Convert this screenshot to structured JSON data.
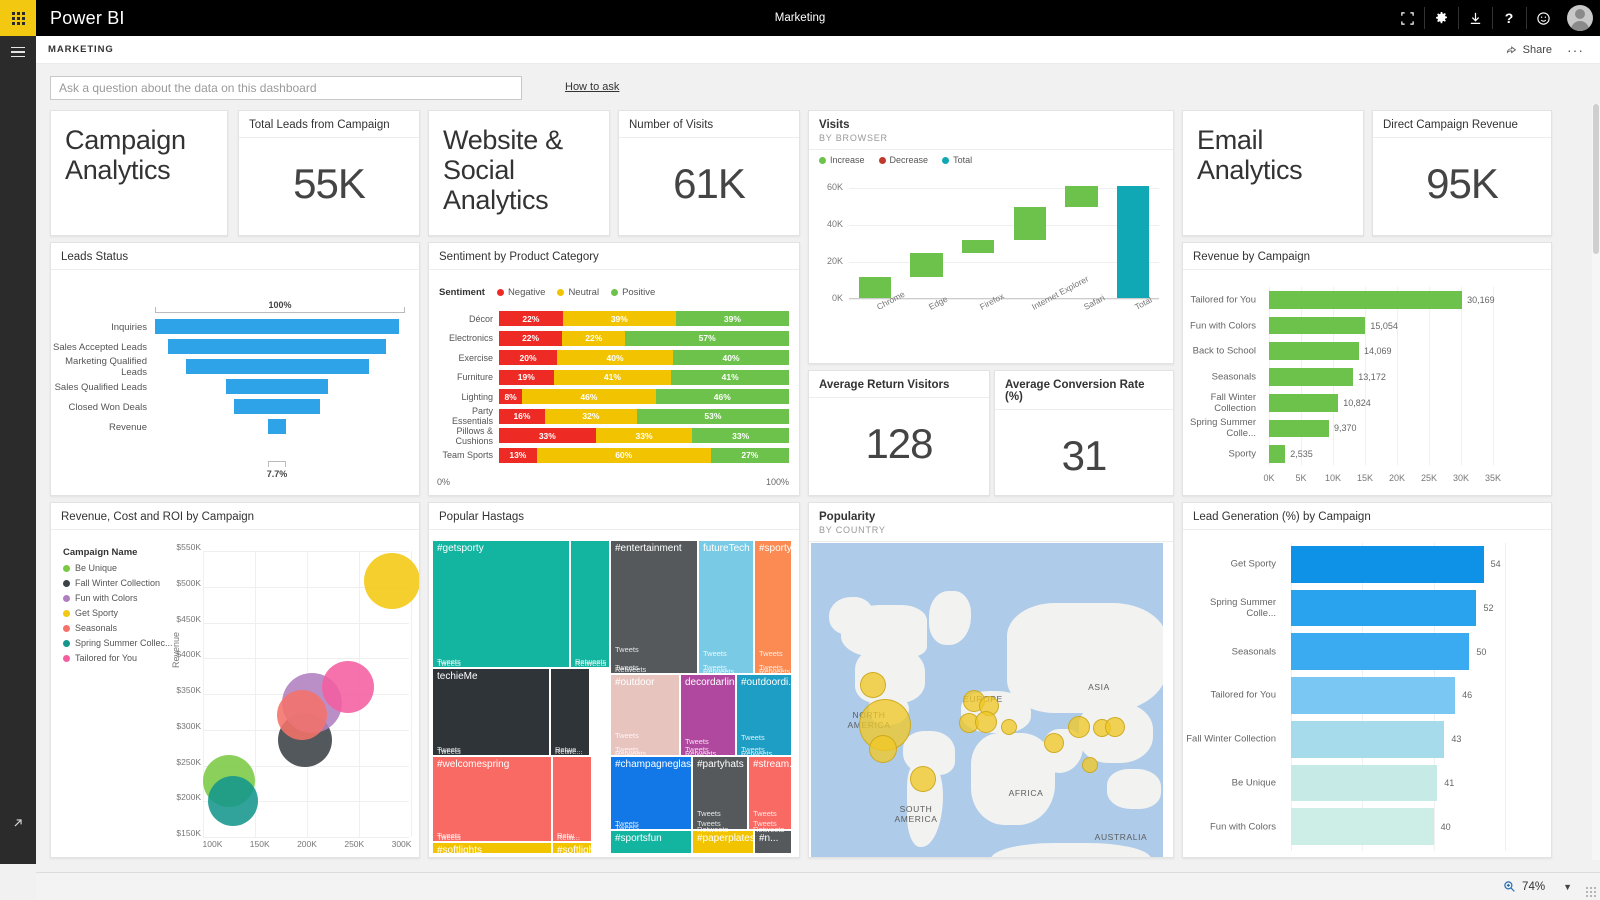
{
  "app": {
    "brand": "Power BI",
    "window_title": "Marketing",
    "waffle_icon": "app-launcher-grid-icon",
    "top_icons": [
      {
        "name": "fullscreen-icon",
        "label": "Full screen"
      },
      {
        "name": "gear-icon",
        "label": "Settings"
      },
      {
        "name": "download-icon",
        "label": "Download"
      },
      {
        "name": "help-icon",
        "label": "?"
      },
      {
        "name": "feedback-smiley-icon",
        "label": "Feedback"
      }
    ],
    "avatar_name": "user-avatar"
  },
  "breadcrumb": {
    "text": "MARKETING",
    "share_label": "Share",
    "share_icon": "share-icon",
    "more_label": "···"
  },
  "qna": {
    "placeholder": "Ask a question about the data on this dashboard",
    "value": "",
    "how_to_ask": "How to ask"
  },
  "status": {
    "zoom_level": "74%",
    "zoom_icon": "magnifier-plus-icon",
    "caret": "▼"
  },
  "tiles": {
    "campaign_analytics": {
      "title": "Campaign\nAnalytics",
      "line1": "Campaign",
      "line2": "Analytics"
    },
    "total_leads": {
      "title": "Total Leads from Campaign",
      "value": "55K"
    },
    "website_social": {
      "line1": "Website & Social",
      "line2": "Analytics"
    },
    "number_of_visits": {
      "title": "Number of Visits",
      "value": "61K"
    },
    "email_analytics": {
      "title": "Email Analytics"
    },
    "direct_campaign_revenue": {
      "title": "Direct Campaign Revenue",
      "value": "95K"
    },
    "leads_status": {
      "title": "Leads Status"
    },
    "sentiment": {
      "title": "Sentiment by Product Category"
    },
    "visits_browser": {
      "title": "Visits",
      "subtitle": "BY BROWSER"
    },
    "avg_return_visitors": {
      "title": "Average Return Visitors",
      "value": "128"
    },
    "avg_conversion_rate": {
      "title": "Average Conversion Rate (%)",
      "value": "31"
    },
    "revenue_by_campaign": {
      "title": "Revenue by Campaign"
    },
    "revenue_cost_roi": {
      "title": "Revenue, Cost and ROI by Campaign"
    },
    "popular_hashtags": {
      "title": "Popular Hastags"
    },
    "popularity": {
      "title": "Popularity",
      "subtitle": "BY COUNTRY"
    },
    "lead_generation": {
      "title": "Lead Generation (%) by Campaign"
    }
  },
  "chart_data": [
    {
      "id": "leads_status",
      "type": "bar",
      "title": "Leads Status",
      "orientation": "funnel",
      "categories": [
        "Inquiries",
        "Sales Accepted Leads",
        "Marketing Qualified Leads",
        "Sales Qualified Leads",
        "Closed Won Deals",
        "Revenue"
      ],
      "values": [
        100,
        89,
        75,
        42,
        35,
        7.7
      ],
      "top_label": "100%",
      "bottom_label": "7.7%",
      "color": "#2fa3e8",
      "xlabel": "",
      "ylabel": ""
    },
    {
      "id": "sentiment_by_product_category",
      "type": "bar",
      "title": "Sentiment by Product Category",
      "stacked": true,
      "legend_title": "Sentiment",
      "legend_position": "top",
      "categories": [
        "Décor",
        "Electronics",
        "Exercise",
        "Furniture",
        "Lighting",
        "Party Essentials",
        "Pillows & Cushions",
        "Team Sports"
      ],
      "series": [
        {
          "name": "Negative",
          "color": "#ee2a24",
          "values": [
            22,
            22,
            20,
            19,
            8,
            16,
            33,
            13
          ]
        },
        {
          "name": "Neutral",
          "color": "#f2c300",
          "values": [
            39,
            22,
            40,
            41,
            46,
            32,
            33,
            60
          ]
        },
        {
          "name": "Positive",
          "color": "#6cc24a",
          "values": [
            39,
            57,
            40,
            41,
            46,
            53,
            33,
            27
          ]
        }
      ],
      "axis_min_label": "0%",
      "axis_max_label": "100%",
      "xlabel": "",
      "ylabel": ""
    },
    {
      "id": "visits_by_browser",
      "type": "bar",
      "chart_style": "waterfall",
      "title": "Visits",
      "subtitle": "BY BROWSER",
      "legend": [
        {
          "name": "Increase",
          "color": "#6cc24a"
        },
        {
          "name": "Decrease",
          "color": "#c0392b"
        },
        {
          "name": "Total",
          "color": "#0fa8b4"
        }
      ],
      "categories": [
        "Chrome",
        "Edge",
        "Firefox",
        "Internet Explorer",
        "Safari",
        "Total"
      ],
      "bar_start": [
        0,
        12000,
        25000,
        32000,
        50000,
        0
      ],
      "bar_end": [
        12000,
        25000,
        32000,
        50000,
        61000,
        61000
      ],
      "values": [
        12000,
        13000,
        7000,
        18000,
        11000,
        61000
      ],
      "ytick_labels": [
        "0K",
        "20K",
        "40K",
        "60K"
      ],
      "ylim": [
        0,
        65000
      ],
      "grid": true,
      "xlabel": "",
      "ylabel": ""
    },
    {
      "id": "revenue_by_campaign",
      "type": "bar",
      "title": "Revenue by Campaign",
      "orientation": "horizontal",
      "categories": [
        "Tailored for You",
        "Fun with Colors",
        "Back to School",
        "Seasonals",
        "Fall Winter Collection",
        "Spring Summer Colle...",
        "Sporty"
      ],
      "values": [
        30169,
        15054,
        14069,
        13172,
        10824,
        9370,
        2535
      ],
      "value_labels": [
        "30,169",
        "15,054",
        "14,069",
        "13,172",
        "10,824",
        "9,370",
        "2,535"
      ],
      "xtick_labels": [
        "0K",
        "5K",
        "10K",
        "15K",
        "20K",
        "25K",
        "30K",
        "35K"
      ],
      "xlim": [
        0,
        35000
      ],
      "color": "#6cc24a",
      "grid": true,
      "xlabel": "",
      "ylabel": ""
    },
    {
      "id": "lead_generation_by_campaign",
      "type": "bar",
      "title": "Lead Generation (%) by Campaign",
      "orientation": "horizontal",
      "categories": [
        "Get Sporty",
        "Spring Summer Colle...",
        "Seasonals",
        "Tailored for You",
        "Fall Winter Collection",
        "Be Unique",
        "Fun with Colors"
      ],
      "values": [
        54,
        52,
        50,
        46,
        43,
        41,
        40
      ],
      "value_labels": [
        "54",
        "52",
        "50",
        "46",
        "43",
        "41",
        "40"
      ],
      "colors": [
        "#0d92e8",
        "#2aa3ef",
        "#3aabf0",
        "#79c7f2",
        "#a6dbec",
        "#c6eae5",
        "#cdeee6"
      ],
      "xlim": [
        0,
        60
      ],
      "grid": true,
      "xlabel": "",
      "ylabel": ""
    },
    {
      "id": "revenue_cost_roi_by_campaign",
      "type": "scatter",
      "title": "Revenue, Cost and ROI by Campaign",
      "legend_title": "Campaign Name",
      "legend_position": "left",
      "ylabel": "Revenue",
      "xlabel": "",
      "ytick_labels": [
        "$550K",
        "$500K",
        "$450K",
        "$400K",
        "$350K",
        "$300K",
        "$250K",
        "$200K",
        "$150K"
      ],
      "xtick_labels": [
        "100K",
        "150K",
        "200K",
        "250K",
        "300K"
      ],
      "ylim": [
        150000,
        550000
      ],
      "xlim": [
        90000,
        310000
      ],
      "points": [
        {
          "name": "Be Unique",
          "color": "#7ac943",
          "x": 118000,
          "y": 228000,
          "r": 26
        },
        {
          "name": "Fall Winter Collection",
          "color": "#3b4147",
          "x": 198000,
          "y": 285000,
          "r": 27
        },
        {
          "name": "Fun with Colors",
          "color": "#b07fc0",
          "x": 205000,
          "y": 338000,
          "r": 30
        },
        {
          "name": "Get Sporty",
          "color": "#f2c811",
          "x": 290000,
          "y": 508000,
          "r": 28
        },
        {
          "name": "Seasonals",
          "color": "#f4726a",
          "x": 195000,
          "y": 320000,
          "r": 25
        },
        {
          "name": "Spring Summer Collec...",
          "color": "#14968c",
          "x": 122000,
          "y": 200000,
          "r": 25
        },
        {
          "name": "Tailored for You",
          "color": "#f45fa0",
          "x": 243000,
          "y": 360000,
          "r": 26
        }
      ]
    },
    {
      "id": "popular_hashtags",
      "type": "treemap",
      "title": "Popular Hastags",
      "sub_metric_labels": [
        "Tweets",
        "Retweets"
      ],
      "tiles": [
        {
          "label": "#getsporty",
          "color": "#13b4a0",
          "tweets_label": "Tweets",
          "retweets_label": "Retweets"
        },
        {
          "label": "techieMe",
          "color": "#2f3438",
          "tweets_label": "Tweets",
          "retweets_label": "Retwe..."
        },
        {
          "label": "#welcomespring",
          "color": "#fa6a64",
          "tweets_label": "Tweets",
          "retweets_label": "Retw..."
        },
        {
          "label": "#softlights",
          "color": "#f2c400",
          "tweets_label": "",
          "retweets_label": ""
        },
        {
          "label": "#entertainment",
          "color": "#55595c",
          "tweets_label": "Tweets",
          "retweets_label": "Retweets"
        },
        {
          "label": "futureTech",
          "color": "#79cbe5",
          "tweets_label": "Tweets",
          "retweets_label": "Retweets"
        },
        {
          "label": "#sportys...",
          "color": "#fb8b53",
          "tweets_label": "Tweets",
          "retweets_label": "Retweets"
        },
        {
          "label": "#outdoor",
          "color": "#e8c4bf",
          "tweets_label": "Tweets",
          "retweets_label": "Retweets"
        },
        {
          "label": "decordarling",
          "color": "#b0489f",
          "tweets_label": "Tweets",
          "retweets_label": "Retweets"
        },
        {
          "label": "#outdoordi...",
          "color": "#1e9ec4",
          "tweets_label": "Tweets",
          "retweets_label": "Retweets"
        },
        {
          "label": "#champagneglass",
          "color": "#1278e8",
          "tweets_label": "Tweets",
          "retweets_label": ""
        },
        {
          "label": "#partyhats",
          "color": "#55595c",
          "tweets_label": "Tweets",
          "retweets_label": "Retweets"
        },
        {
          "label": "#stream...",
          "color": "#fa6a64",
          "tweets_label": "Tweets",
          "retweets_label": "Retweets"
        },
        {
          "label": "#sportsfun",
          "color": "#13b4a0",
          "tweets_label": "",
          "retweets_label": ""
        },
        {
          "label": "#paperplates",
          "color": "#f2c400",
          "tweets_label": "",
          "retweets_label": ""
        },
        {
          "label": "#n...",
          "color": "#55595c",
          "tweets_label": "",
          "retweets_label": ""
        }
      ]
    },
    {
      "id": "popularity_by_country",
      "type": "scatter",
      "chart_style": "bubble-map",
      "title": "Popularity",
      "subtitle": "BY COUNTRY",
      "continent_labels": [
        "NORTH AMERICA",
        "SOUTH AMERICA",
        "EUROPE",
        "AFRICA",
        "ASIA",
        "AUSTRALIA"
      ],
      "bubble_color": "#f0c828",
      "ocean_color": "#aecbea",
      "land_color": "#f2f2f0",
      "bubbles": [
        {
          "x": 62,
          "y": 142,
          "r": 13
        },
        {
          "x": 74,
          "y": 182,
          "r": 26
        },
        {
          "x": 72,
          "y": 206,
          "r": 14
        },
        {
          "x": 112,
          "y": 236,
          "r": 13
        },
        {
          "x": 163,
          "y": 158,
          "r": 11
        },
        {
          "x": 178,
          "y": 163,
          "r": 10
        },
        {
          "x": 158,
          "y": 180,
          "r": 10
        },
        {
          "x": 175,
          "y": 179,
          "r": 11
        },
        {
          "x": 198,
          "y": 184,
          "r": 8
        },
        {
          "x": 243,
          "y": 200,
          "r": 10
        },
        {
          "x": 268,
          "y": 184,
          "r": 11
        },
        {
          "x": 291,
          "y": 185,
          "r": 9
        },
        {
          "x": 304,
          "y": 184,
          "r": 10
        },
        {
          "x": 279,
          "y": 222,
          "r": 8
        }
      ]
    }
  ]
}
